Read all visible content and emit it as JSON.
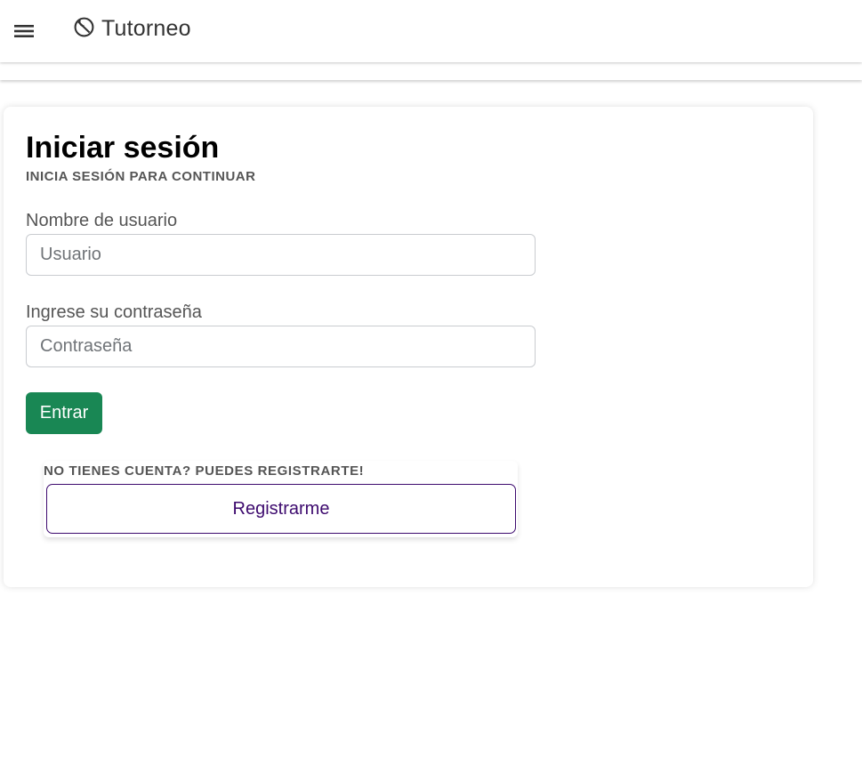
{
  "app": {
    "name": "Tutorneo",
    "menu_icon": "hamburger-menu-icon",
    "brand_icon": "soccer-ball-icon"
  },
  "login": {
    "title": "Iniciar sesión",
    "subtitle": "INICIA SESIÓN PARA CONTINUAR",
    "username": {
      "label": "Nombre de usuario",
      "placeholder": "Usuario",
      "value": ""
    },
    "password": {
      "label": "Ingrese su contraseña",
      "placeholder": "Contraseña",
      "value": ""
    },
    "submit_label": "Entrar"
  },
  "register": {
    "note": "NO TIENES CUENTA? PUEDES REGISTRARTE!",
    "button_label": "Registrarme"
  },
  "colors": {
    "primary": "#198754",
    "register_accent": "#3d0a6e",
    "muted_text": "#555555"
  }
}
